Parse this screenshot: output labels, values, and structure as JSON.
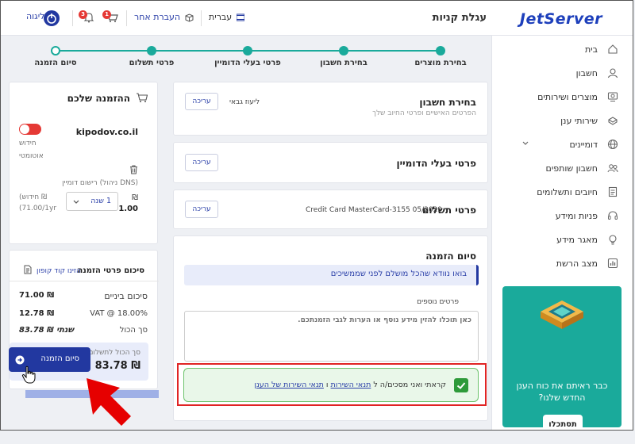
{
  "header": {
    "logo": "JetServer",
    "page_title": "עגלת קניות",
    "language": "עברית",
    "transfer": "העברת אחר",
    "logout": "ליגוה",
    "cart_count": "1",
    "bell_count": "3"
  },
  "sidebar": {
    "items": [
      {
        "label": "בית",
        "icon": "home-icon"
      },
      {
        "label": "חשבון",
        "icon": "user-icon"
      },
      {
        "label": "מוצרים ושירותים",
        "icon": "product-icon"
      },
      {
        "label": "שירותי ענן",
        "icon": "cloud-icon"
      },
      {
        "label": "דומיינים",
        "icon": "globe-icon"
      },
      {
        "label": "חשבון שותפים",
        "icon": "partners-icon"
      },
      {
        "label": "חיובים ותשלומים",
        "icon": "invoice-icon"
      },
      {
        "label": "פניות ומידע",
        "icon": "headset-icon"
      },
      {
        "label": "מאגר מידע",
        "icon": "bulb-icon"
      },
      {
        "label": "מצב הרשת",
        "icon": "chart-icon"
      }
    ],
    "promo": {
      "text": "כבר ראיתם את כוח הענן החדש שלנו?",
      "button": "תסתכלו"
    }
  },
  "stepper": {
    "steps": [
      "בחירת מוצרים",
      "בחירת חשבון",
      "פרטי בעלי הדומיין",
      "פרטי תשלום",
      "סיום הזמנה"
    ]
  },
  "account_card": {
    "title": "בחירת חשבון",
    "subtitle": "הפרטים האישיים ופרטי החיוב שלך",
    "value": "ליעוז גבאי",
    "edit": "עריכה"
  },
  "domain_owner_card": {
    "title": "פרטי בעלי הדומיין",
    "edit": "עריכה"
  },
  "payment_card": {
    "title": "פרטי תשלום",
    "value": "Credit Card MasterCard-3155 05/2029",
    "edit": "עריכה"
  },
  "finish_card": {
    "title": "סיום הזמנה",
    "notice": "בואו נוודא שהכל מושלם לפני שממשיכים",
    "notes_label": "פרטים נוספים",
    "notes_placeholder": "כאן תוכלו להזין מידע נוסף או הערות לגבי הזמנתכם.",
    "terms_prefix": "קראתי ואני מסכים/ה ל ",
    "terms_link1": "תנאי השירות",
    "terms_sep": " ו ",
    "terms_link2": "תנאי השירות של הענן"
  },
  "order": {
    "title": "ההזמנה שלכם",
    "domain": "kipodov.co.il",
    "renew_line1": "חידוש",
    "renew_line2": "אוטומטי",
    "item_desc": "רישום דומיין (ניהול DNS)",
    "period": "1 שנה",
    "price": "71.00",
    "currency": "₪",
    "renew_label": "(חידוש ₪",
    "renew_price": "(71.00/1yr"
  },
  "summary": {
    "title": "סיכום פרטי הזמנה",
    "coupon": "הזינו קוד קופון",
    "rows": [
      {
        "label": "סיכום ביניים",
        "value": "71.00 ₪"
      },
      {
        "label": "VAT @ 18.00%",
        "value": "12.78 ₪"
      },
      {
        "label": "סך הכול",
        "value": "83.78 ₪ שנתי"
      }
    ],
    "total_label": "סך הכול לתשלום",
    "total_value": "83.78 ₪",
    "submit": "סיום הזמנה"
  },
  "colors": {
    "accent": "#1aaa9b",
    "brand": "#1d3fbb",
    "button": "#2238a0",
    "arrow": "#e60000"
  }
}
